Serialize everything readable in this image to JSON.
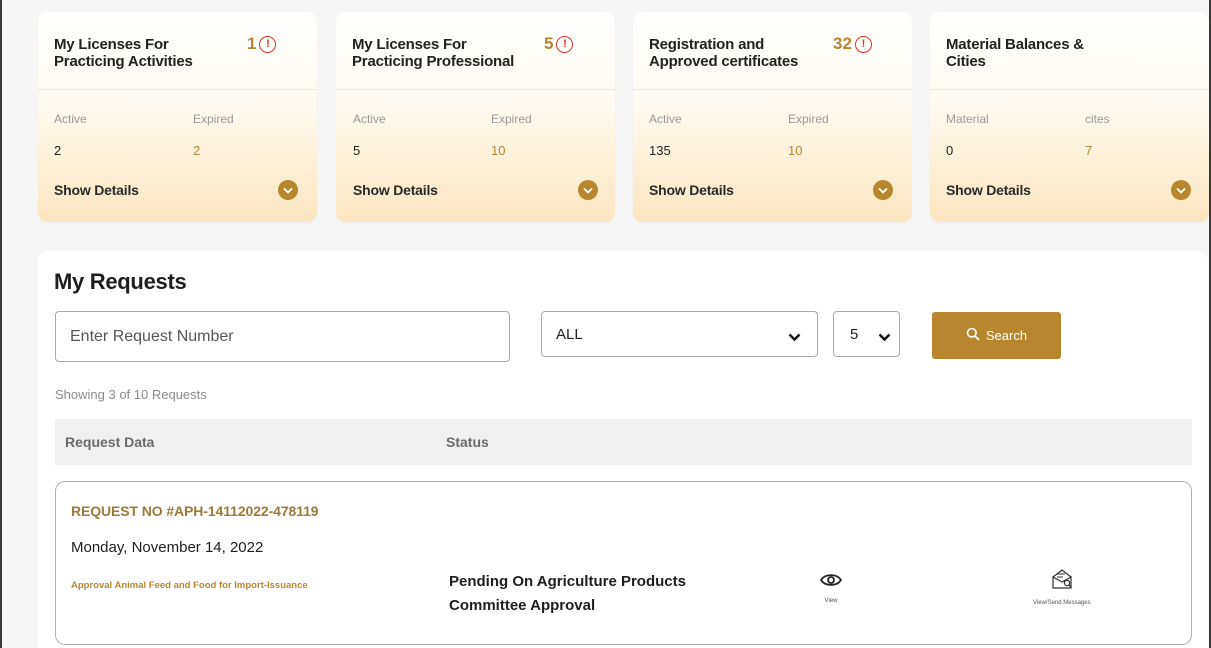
{
  "summary_cards": [
    {
      "title": "My Licenses For Practicing Activities",
      "count": "1",
      "left_label": "Active",
      "left_value": "2",
      "right_label": "Expired",
      "right_value": "2",
      "details_label": "Show Details"
    },
    {
      "title": "My Licenses For Practicing Professional",
      "count": "5",
      "left_label": "Active",
      "left_value": "5",
      "right_label": "Expired",
      "right_value": "10",
      "details_label": "Show Details"
    },
    {
      "title": "Registration and Approved certificates",
      "count": "32",
      "left_label": "Active",
      "left_value": "135",
      "right_label": "Expired",
      "right_value": "10",
      "details_label": "Show Details"
    },
    {
      "title": "Material Balances & Cities",
      "count": "",
      "left_label": "Material",
      "left_value": "0",
      "right_label": "cites",
      "right_value": "7",
      "details_label": "Show Details"
    }
  ],
  "requests": {
    "title": "My Requests",
    "search_placeholder": "Enter Request Number",
    "status_filter": "ALL",
    "page_size": "5",
    "search_label": "Search",
    "showing_text": "Showing 3 of 10 Requests",
    "columns": [
      "Request Data",
      "Status"
    ],
    "items": [
      {
        "request_no": "REQUEST NO #APH-14112022-478119",
        "date": "Monday, November 14, 2022",
        "service": "Approval Animal Feed and Food for Import-Issuance",
        "status_line1": "Pending On Agriculture Products",
        "status_line2": "Committee Approval",
        "view_label": "View",
        "messages_label": "View/Send Messages"
      }
    ]
  },
  "colors": {
    "accent": "#b8862e",
    "alert": "#d9372b"
  }
}
